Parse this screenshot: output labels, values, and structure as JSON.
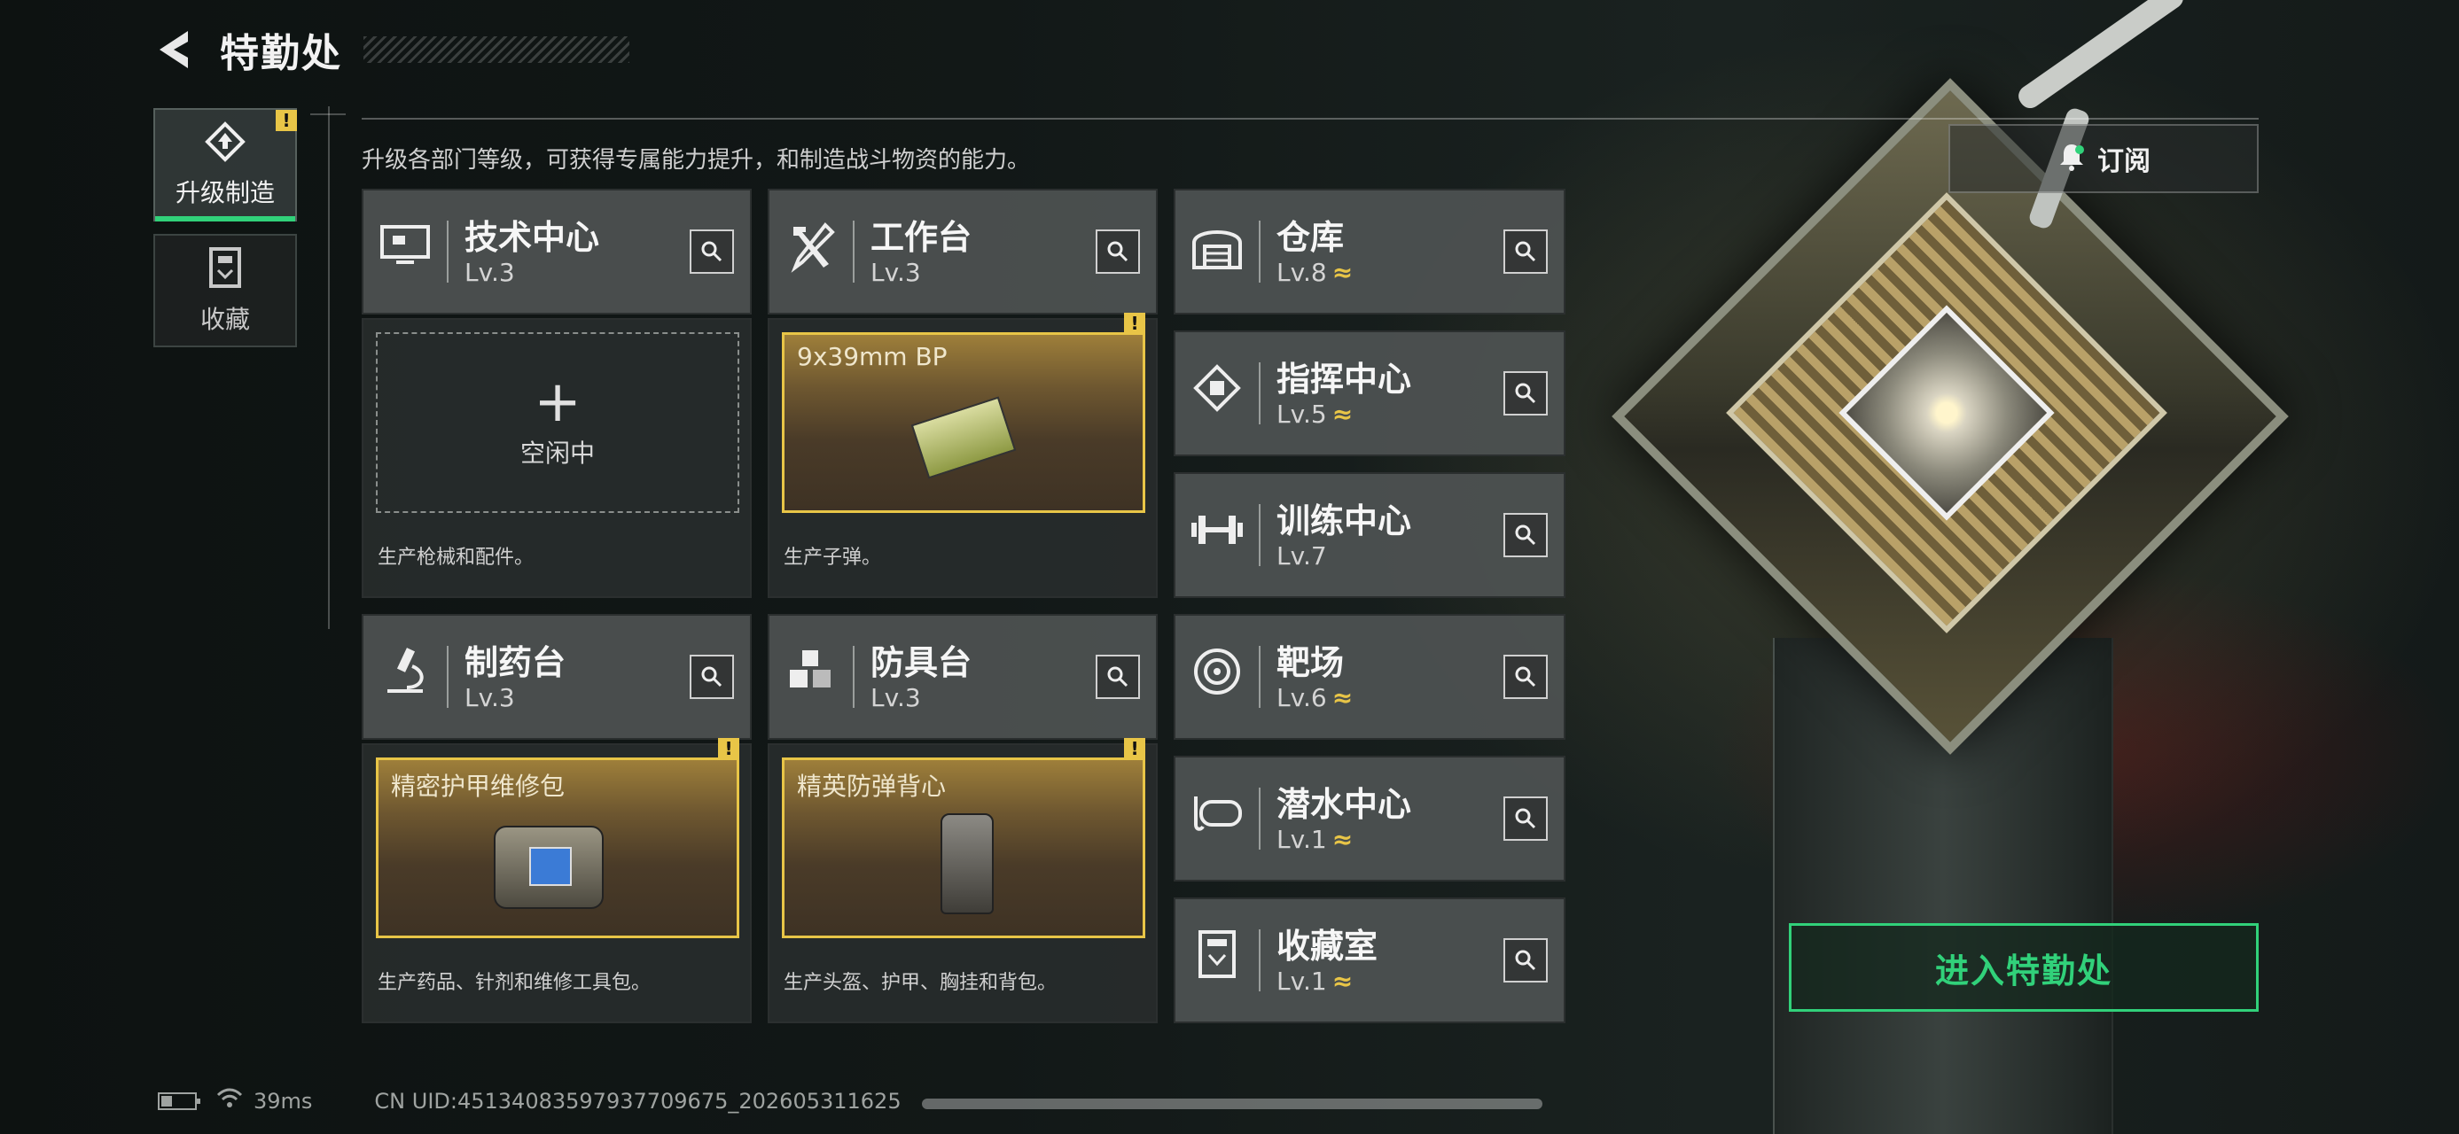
{
  "header": {
    "title": "特勤处"
  },
  "sidebar": {
    "items": [
      {
        "label": "升级制造",
        "active": true,
        "alert": "!"
      },
      {
        "label": "收藏",
        "active": false
      }
    ]
  },
  "description": "升级各部门等级，可获得专属能力提升，和制造战斗物资的能力。",
  "subscribe": {
    "label": "订阅"
  },
  "workstations": [
    {
      "name": "技术中心",
      "level": "Lv.3",
      "slot": {
        "type": "empty",
        "label": "空闲中"
      },
      "desc": "生产枪械和配件。"
    },
    {
      "name": "工作台",
      "level": "Lv.3",
      "slot": {
        "type": "item",
        "item": "9x39mm BP",
        "alert": "!"
      },
      "desc": "生产子弹。"
    },
    {
      "name": "制药台",
      "level": "Lv.3",
      "slot": {
        "type": "item",
        "item": "精密护甲维修包",
        "alert": "!"
      },
      "desc": "生产药品、针剂和维修工具包。"
    },
    {
      "name": "防具台",
      "level": "Lv.3",
      "slot": {
        "type": "item",
        "item": "精英防弹背心",
        "alert": "!"
      },
      "desc": "生产头盔、护甲、胸挂和背包。"
    }
  ],
  "facilities": [
    {
      "name": "仓库",
      "level": "Lv.8",
      "upgradable": true
    },
    {
      "name": "指挥中心",
      "level": "Lv.5",
      "upgradable": true
    },
    {
      "name": "训练中心",
      "level": "Lv.7",
      "upgradable": false
    },
    {
      "name": "靶场",
      "level": "Lv.6",
      "upgradable": true
    },
    {
      "name": "潜水中心",
      "level": "Lv.1",
      "upgradable": true
    },
    {
      "name": "收藏室",
      "level": "Lv.1",
      "upgradable": true
    }
  ],
  "upgrade_glyph": "≈",
  "enter_button": {
    "label": "进入特勤处"
  },
  "status": {
    "ping": "39ms",
    "uid": "CN UID:4513408359793770967​5_202605311625"
  },
  "colors": {
    "accent_green": "#31d17a",
    "highlight_gold": "#e8c547"
  }
}
